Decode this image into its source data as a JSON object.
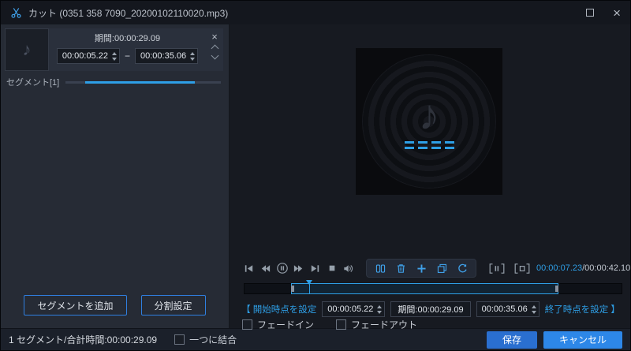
{
  "titlebar": {
    "title": "カット (0351 358 7090_20200102110020.mp3)"
  },
  "glyphs": {
    "close": "×",
    "music_note": "♪"
  },
  "left_panel": {
    "segment": {
      "duration_label": "期間:00:00:29.09",
      "start_time": "00:00:05.22",
      "separator": "−",
      "end_time": "00:00:35.06"
    },
    "segment_name": "セグメント[1]",
    "add_segment_button": "セグメントを追加",
    "split_settings_button": "分割設定"
  },
  "player": {
    "current_time": "00:00:07.23",
    "total_time": "/00:00:42.10",
    "control_icons": [
      "skip-start",
      "rewind",
      "pause",
      "fast-forward",
      "skip-end",
      "stop",
      "volume"
    ],
    "tool_icons": [
      "split",
      "delete",
      "add",
      "copy",
      "reset"
    ],
    "segment_icons": [
      "preview-segment",
      "stop-segment"
    ]
  },
  "timeline": {
    "selection_start_pct": 12.4,
    "selection_end_pct": 83.3,
    "playhead_pct": 17.2
  },
  "edit_bar": {
    "set_start_label": "【 開始時点を設定",
    "start_time": "00:00:05.22",
    "duration_text": "期間:00:00:29.09",
    "end_time": "00:00:35.06",
    "set_end_label": "終了時点を設定 】",
    "fade_in": "フェードイン",
    "fade_out": "フェードアウト"
  },
  "footer": {
    "summary": "1 セグメント/合計時間:00:00:29.09",
    "merge_label": "一つに結合",
    "save_button": "保存",
    "cancel_button": "キャンセル"
  },
  "colors": {
    "accent_blue": "#2e9fe6",
    "icon_blue": "#3fa0e8",
    "save_button_blue": "#2a6fd0",
    "cancel_button_blue": "#2d87e8",
    "panel_bg": "#262b35",
    "window_bg": "#171a21"
  }
}
